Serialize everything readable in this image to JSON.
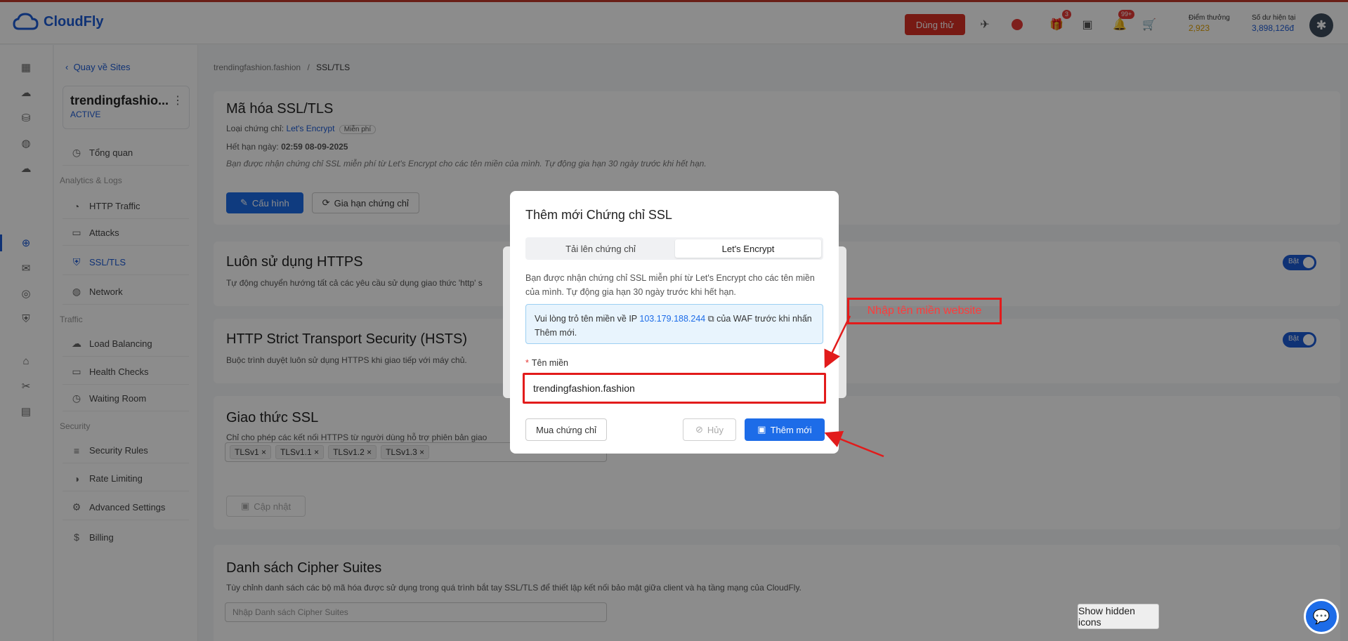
{
  "topbar": {
    "logo": "CloudFly",
    "trial_button": "Dùng thử",
    "gift_badge": "3",
    "bell_badge": "99+",
    "points_label": "Điểm thưởng",
    "points_value": "2,923",
    "balance_label": "Số dư hiện tại",
    "balance_value": "3,898,126đ"
  },
  "sitenav": {
    "back": "Quay về Sites",
    "site_name": "trendingfashio...",
    "site_status": "ACTIVE",
    "overview": "Tổng quan",
    "group_analytics": "Analytics & Logs",
    "http_traffic": "HTTP Traffic",
    "attacks": "Attacks",
    "ssl_tls": "SSL/TLS",
    "network": "Network",
    "group_traffic": "Traffic",
    "load_balancing": "Load Balancing",
    "health_checks": "Health Checks",
    "waiting_room": "Waiting Room",
    "group_security": "Security",
    "security_rules": "Security Rules",
    "rate_limiting": "Rate Limiting",
    "advanced_settings": "Advanced Settings",
    "billing": "Billing"
  },
  "breadcrumb": {
    "site": "trendingfashion.fashion",
    "sep": "/",
    "current": "SSL/TLS"
  },
  "ssl_card": {
    "title": "Mã hóa SSL/TLS",
    "cert_type_label": "Loại chứng chỉ:",
    "cert_type_value": "Let's Encrypt",
    "free_tag": "Miễn phí",
    "expiry_label": "Hết hạn ngày:",
    "expiry_value": "02:59 08-09-2025",
    "note": "Bạn được nhận chứng chỉ SSL miễn phí từ Let's Encrypt cho các tên miền của mình. Tự động gia hạn 30 ngày trước khi hết hạn.",
    "config_button": "Cấu hình",
    "renew_button": "Gia hạn chứng chỉ"
  },
  "https_card": {
    "title": "Luôn sử dụng HTTPS",
    "desc": "Tự động chuyển hướng tất cả các yêu cầu sử dụng giao thức 'http' s",
    "toggle": "Bật"
  },
  "hsts_card": {
    "title": "HTTP Strict Transport Security (HSTS)",
    "desc": "Buộc trình duyệt luôn sử dụng HTTPS khi giao tiếp với máy chủ.",
    "toggle": "Bật"
  },
  "protocol_card": {
    "title": "Giao thức SSL",
    "desc": "Chỉ cho phép các kết nối HTTPS từ người dùng hỗ trợ phiên bản giao",
    "tags": [
      "TLSv1",
      "TLSv1.1",
      "TLSv1.2",
      "TLSv1.3"
    ],
    "update_button": "Cập nhật"
  },
  "cipher_card": {
    "title": "Danh sách Cipher Suites",
    "desc": "Tùy chỉnh danh sách các bộ mã hóa được sử dụng trong quá trình bắt tay SSL/TLS để thiết lập kết nối bảo mật giữa client và hạ tầng mạng của CloudFly.",
    "placeholder": "Nhập Danh sách Cipher Suites"
  },
  "modal": {
    "title": "Thêm mới Chứng chỉ SSL",
    "tab_upload": "Tải lên chứng chỉ",
    "tab_letsencrypt": "Let's Encrypt",
    "desc": "Bạn được nhận chứng chỉ SSL miễn phí từ Let's Encrypt cho các tên miền của mình. Tự động gia hạn 30 ngày trước khi hết hạn.",
    "info_prefix": "Vui lòng trỏ tên miền về IP",
    "info_ip": "103.179.188.244",
    "info_suffix": "của WAF trước khi nhấn Thêm mới.",
    "domain_label": "Tên miền",
    "domain_value": "trendingfashion.fashion",
    "buy_button": "Mua chứng chỉ",
    "cancel_button": "Hủy",
    "add_button": "Thêm mới"
  },
  "annotation": {
    "text": "Nhập tên miền website"
  },
  "show_hidden_icons": "Show hidden icons",
  "colors": {
    "accent": "#1d6ce8",
    "annotation": "#e21b1b",
    "trial": "#d93025"
  }
}
